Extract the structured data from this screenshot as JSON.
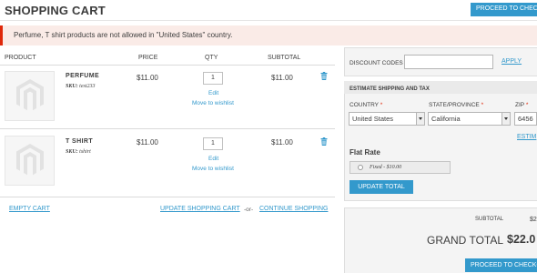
{
  "page": {
    "title": "SHOPPING CART",
    "checkout_top_label": "PROCEED TO CHECKOUT",
    "message": "Perfume, T shirt products are not allowed in \"United States\" country."
  },
  "table": {
    "headers": [
      "PRODUCT",
      "PRICE",
      "QTY",
      "SUBTOTAL"
    ]
  },
  "items": [
    {
      "name": "PERFUME",
      "sku_label": "SKU:",
      "sku": "test233",
      "price": "$11.00",
      "qty": "1",
      "subtotal": "$11.00",
      "edit": "Edit",
      "wishlist": "Move to wishlist"
    },
    {
      "name": "T SHIRT",
      "sku_label": "SKU:",
      "sku": "tshirt",
      "price": "$11.00",
      "qty": "1",
      "subtotal": "$11.00",
      "edit": "Edit",
      "wishlist": "Move to wishlist"
    }
  ],
  "actions": {
    "empty_cart": "EMPTY CART",
    "update_cart": "UPDATE SHOPPING CART",
    "separator": "-or-",
    "continue": "CONTINUE SHOPPING"
  },
  "discount": {
    "label": "DISCOUNT CODES",
    "value": "",
    "apply": "APPLY"
  },
  "estimate": {
    "title": "ESTIMATE SHIPPING AND TAX",
    "country_label": "COUNTRY",
    "country_value": "United States",
    "state_label": "STATE/PROVINCE",
    "state_value": "California",
    "zip_label": "ZIP",
    "zip_value": "6456",
    "req_mark": "*",
    "estimate_link": "ESTIM",
    "flat_rate": "Flat Rate",
    "rate_option": "Fixed - $10.00",
    "update_total": "UPDATE TOTAL"
  },
  "totals": {
    "subtotal_label": "SUBTOTAL",
    "subtotal_value": "$2",
    "grand_total_label": "GRAND TOTAL",
    "grand_total_value": "$22.0",
    "checkout_bottom_label": "PROCEED TO CHECKOUT"
  },
  "colors": {
    "accent": "#3399cc",
    "error": "#df280a",
    "message_bg": "#faebe7"
  }
}
